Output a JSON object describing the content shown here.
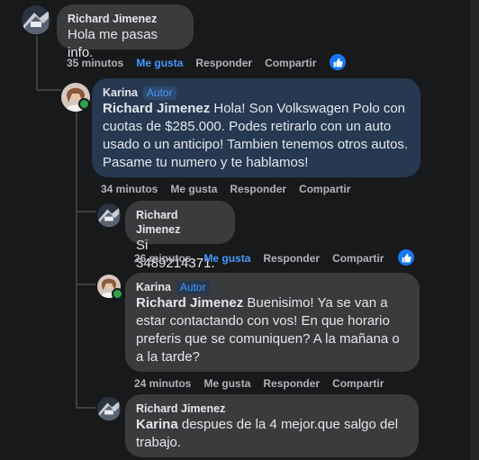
{
  "comments": [
    {
      "author": "Richard Jimenez",
      "text": "Hola me pasas info.",
      "time": "35 minutos",
      "actions": [
        "Me gusta",
        "Responder",
        "Compartir"
      ],
      "liked": true,
      "reaction_icon": "like-icon"
    },
    {
      "author": "Karina",
      "badge": "Autor",
      "mention": "Richard Jimenez",
      "text": " Hola! Son Volkswagen Polo con cuotas de $285.000. Podes retirarlo con un auto usado o un anticipo! Tambien tenemos otros autos. Pasame tu numero y te hablamos!",
      "time": "34 minutos",
      "actions": [
        "Me gusta",
        "Responder",
        "Compartir"
      ],
      "liked": false
    },
    {
      "author": "Richard Jimenez",
      "text": "Si 3489214371.",
      "time": "26 minutos",
      "actions": [
        "Me gusta",
        "Responder",
        "Compartir"
      ],
      "liked": true,
      "reaction_icon": "like-icon"
    },
    {
      "author": "Karina",
      "badge": "Autor",
      "mention": "Richard Jimenez",
      "text": " Buenisimo! Ya se van a estar contactando con vos! En que horario preferis que se comuniquen? A la mañana o a la tarde?",
      "time": "24 minutos",
      "actions": [
        "Me gusta",
        "Responder",
        "Compartir"
      ],
      "liked": false
    },
    {
      "author": "Richard Jimenez",
      "mention": "Karina",
      "text": " despues de la 4 mejor.que salgo del trabajo.",
      "time": "",
      "actions": []
    }
  ],
  "colors": {
    "background": "#18191a",
    "bubble": "#3a3b3c",
    "highlight_bubble": "#263951",
    "link_blue": "#4599ff",
    "meta_gray": "#b0b3b8",
    "online_green": "#31a24c"
  }
}
